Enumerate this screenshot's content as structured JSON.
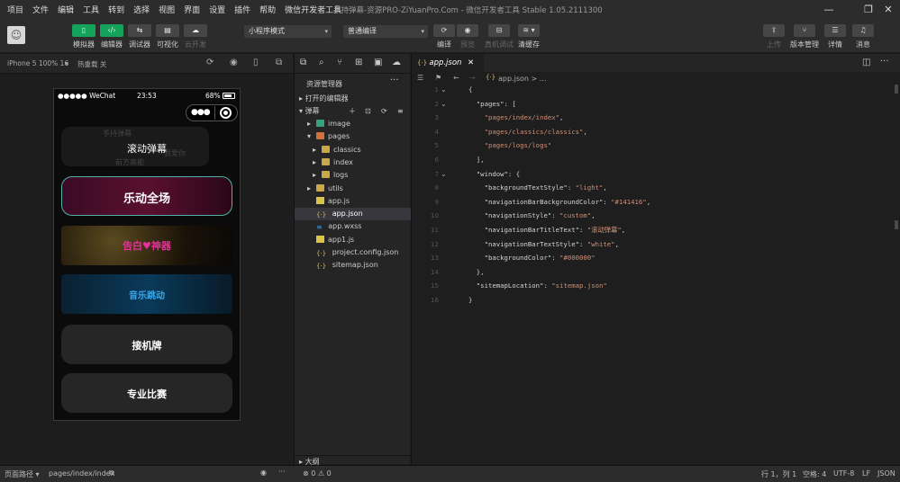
{
  "menu": [
    "项目",
    "文件",
    "编辑",
    "工具",
    "转到",
    "选择",
    "视图",
    "界面",
    "设置",
    "插件",
    "帮助",
    "微信开发者工具"
  ],
  "window_title": "手持弹幕-资源PRO-ZiYuanPro.Com - 微信开发者工具 Stable 1.05.2111300",
  "toolbar": {
    "left_buttons": [
      {
        "label": "模拟器",
        "icon": "phone-icon",
        "active": true
      },
      {
        "label": "编辑器",
        "icon": "code-icon",
        "active": true
      },
      {
        "label": "调试器",
        "icon": "debug-icon",
        "active": false
      },
      {
        "label": "可视化",
        "icon": "layout-icon",
        "active": false
      },
      {
        "label": "云开发",
        "icon": "cloud-icon",
        "active": false
      }
    ],
    "mode_select": "小程序模式",
    "compile_select": "普通编译",
    "mid_buttons": [
      "编译",
      "预览",
      "真机调试",
      "清缓存"
    ],
    "right_buttons": [
      "上传",
      "版本管理",
      "详情",
      "消息"
    ]
  },
  "simulator": {
    "device": "iPhone 5 100% 16",
    "hot_reload": "热重载 关",
    "status": {
      "carrier": "●●●●● WeChat",
      "time": "23:53",
      "battery": "68%"
    },
    "page_title": "滚动弹幕",
    "cards": [
      "乐动全场",
      "告白♥神器",
      "音乐跳动",
      "接机牌",
      "专业比赛"
    ]
  },
  "explorer": {
    "title": "资源管理器",
    "open_editors": "打开的编辑器",
    "project": "弹幕",
    "outline": "大纲",
    "tree": [
      {
        "name": "image",
        "type": "folder-img",
        "depth": 1,
        "arrow": "▸"
      },
      {
        "name": "pages",
        "type": "folder-pg",
        "depth": 1,
        "arrow": "▾"
      },
      {
        "name": "classics",
        "type": "folder",
        "depth": 2,
        "arrow": "▸"
      },
      {
        "name": "index",
        "type": "folder",
        "depth": 2,
        "arrow": "▸"
      },
      {
        "name": "logs",
        "type": "folder",
        "depth": 2,
        "arrow": "▸"
      },
      {
        "name": "utils",
        "type": "folder",
        "depth": 1,
        "arrow": "▸"
      },
      {
        "name": "app.js",
        "type": "js",
        "depth": 1,
        "arrow": ""
      },
      {
        "name": "app.json",
        "type": "json",
        "depth": 1,
        "arrow": "",
        "active": true
      },
      {
        "name": "app.wxss",
        "type": "wxss",
        "depth": 1,
        "arrow": ""
      },
      {
        "name": "app1.js",
        "type": "js",
        "depth": 1,
        "arrow": ""
      },
      {
        "name": "project.config.json",
        "type": "json",
        "depth": 1,
        "arrow": ""
      },
      {
        "name": "sitemap.json",
        "type": "json",
        "depth": 1,
        "arrow": ""
      }
    ]
  },
  "editor": {
    "tab": "app.json",
    "breadcrumb": "app.json > ...",
    "lines": [
      [
        [
          "k",
          "{"
        ]
      ],
      [
        [
          "k",
          "  \"pages\": ["
        ]
      ],
      [
        [
          "s",
          "    \"pages/index/index\""
        ],
        [
          "k",
          ","
        ]
      ],
      [
        [
          "s",
          "    \"pages/classics/classics\""
        ],
        [
          "k",
          ","
        ]
      ],
      [
        [
          "s",
          "    \"pages/logs/logs\""
        ]
      ],
      [
        [
          "k",
          "  ],"
        ]
      ],
      [
        [
          "k",
          "  \"window\": {"
        ]
      ],
      [
        [
          "k",
          "    \"backgroundTextStyle\": "
        ],
        [
          "s",
          "\"light\""
        ],
        [
          "k",
          ","
        ]
      ],
      [
        [
          "k",
          "    \"navigationBarBackgroundColor\": "
        ],
        [
          "s",
          "\"#141416\""
        ],
        [
          "k",
          ","
        ]
      ],
      [
        [
          "k",
          "    \"navigationStyle\": "
        ],
        [
          "s",
          "\"custom\""
        ],
        [
          "k",
          ","
        ]
      ],
      [
        [
          "k",
          "    \"navigationBarTitleText\": "
        ],
        [
          "s",
          "\"滚动弹幕\""
        ],
        [
          "k",
          ","
        ]
      ],
      [
        [
          "k",
          "    \"navigationBarTextStyle\": "
        ],
        [
          "s",
          "\"white\""
        ],
        [
          "k",
          ","
        ]
      ],
      [
        [
          "k",
          "    \"backgroundColor\": "
        ],
        [
          "s",
          "\"#000000\""
        ]
      ],
      [
        [
          "k",
          "  },"
        ]
      ],
      [
        [
          "k",
          "  \"sitemapLocation\": "
        ],
        [
          "s",
          "\"sitemap.json\""
        ]
      ],
      [
        [
          "k",
          "}"
        ]
      ]
    ]
  },
  "status": {
    "page_path_label": "页面路径",
    "page_path": "pages/index/index",
    "errors": "⊗ 0 ⚠ 0",
    "cursor": "行 1，列 1",
    "spaces": "空格: 4",
    "encoding": "UTF-8",
    "eol": "LF",
    "language": "JSON"
  }
}
